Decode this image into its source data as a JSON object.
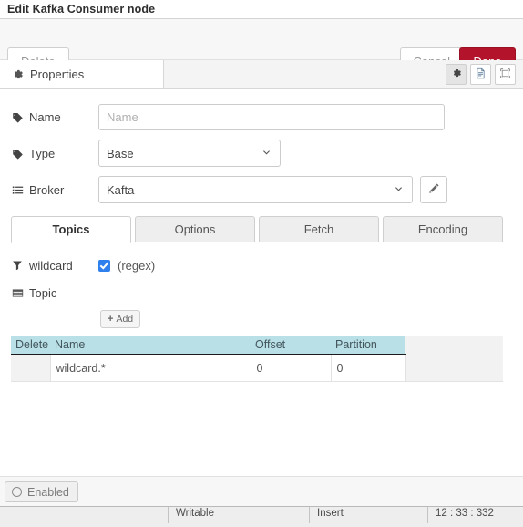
{
  "window": {
    "title": "Edit Kafka Consumer node"
  },
  "toolbar": {
    "delete_label": "Delete",
    "cancel_label": "Cancel",
    "done_label": "Done",
    "done_color": "#b3132b"
  },
  "section_tabs": {
    "active": "Properties",
    "items": [
      {
        "label": "Properties",
        "icon": "gear-icon"
      }
    ],
    "right_icons": [
      {
        "name": "gear-icon",
        "active": true
      },
      {
        "name": "description-icon",
        "active": false
      },
      {
        "name": "appearance-icon",
        "active": false
      }
    ]
  },
  "form": {
    "name": {
      "label": "Name",
      "icon": "tag-icon",
      "value": "",
      "placeholder": "Name"
    },
    "type": {
      "label": "Type",
      "icon": "tag-icon",
      "value": "Base",
      "options": [
        "Base"
      ]
    },
    "broker": {
      "label": "Broker",
      "icon": "list-icon",
      "value": "Kafta",
      "options": [
        "Kafta"
      ],
      "edit_icon": "pencil-icon"
    }
  },
  "inner_tabs": {
    "active": "Topics",
    "items": [
      "Topics",
      "Options",
      "Fetch",
      "Encoding"
    ]
  },
  "topics_pane": {
    "wildcard": {
      "label": "wildcard",
      "icon": "filter-icon",
      "checked": true,
      "note": "(regex)"
    },
    "topic": {
      "label": "Topic",
      "icon": "table-icon"
    },
    "add_button": {
      "label": "Add",
      "icon": "plus-icon"
    },
    "table": {
      "columns": [
        "Delete",
        "Name",
        "Offset",
        "Partition",
        ""
      ],
      "rows": [
        {
          "delete": "",
          "name": "wildcard.*",
          "offset": "0",
          "partition": "0",
          "tail": ""
        }
      ],
      "header_bg": "#b8e0e6"
    }
  },
  "footer": {
    "enabled_toggle": {
      "label": "Enabled",
      "icon": "circle-icon",
      "on": false
    }
  },
  "status_bar": {
    "spacer": "",
    "writable": "Writable",
    "insert": "Insert",
    "position": "12 : 33 : 332"
  }
}
